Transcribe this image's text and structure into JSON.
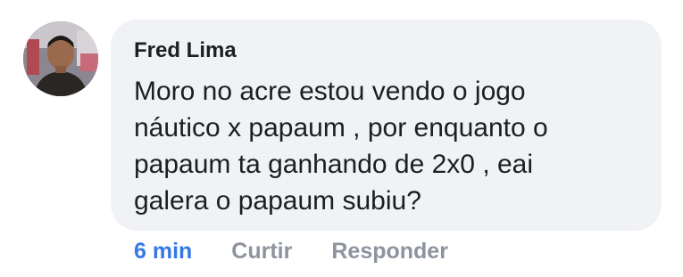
{
  "comment": {
    "author": "Fred Lima",
    "text_lines": [
      "Moro no acre estou vendo o jogo",
      "náutico x papaum , por enquanto o",
      "papaum ta ganhando de 2x0 ,  eai",
      "galera o papaum subiu?"
    ],
    "timestamp": "6 min",
    "actions": {
      "like_label": "Curtir",
      "reply_label": "Responder"
    }
  },
  "colors": {
    "bubble_bg": "#f0f2f5",
    "text": "#1c1e21",
    "timestamp": "#3578e5",
    "action": "#8d949e"
  },
  "icons": {
    "avatar": "user-avatar-photo"
  }
}
